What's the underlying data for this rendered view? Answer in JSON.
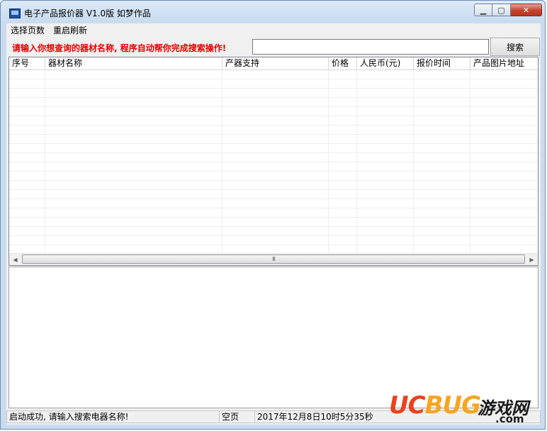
{
  "window": {
    "title": "电子产品报价器 V1.0版 如梦作品",
    "minimize_glyph": "▁",
    "maximize_glyph": "▢",
    "close_glyph": "✕"
  },
  "menu": {
    "items": [
      "选择页数",
      "重启刷新"
    ]
  },
  "search": {
    "prompt": "请输入你想查询的器材名称, 程序自动帮你完成搜索操作!",
    "input_value": "",
    "button_label": "搜索"
  },
  "table": {
    "columns": [
      "序号",
      "器材名称",
      "产器支持",
      "价格",
      "人民币(元)",
      "报价时间",
      "产品图片地址"
    ],
    "rows": []
  },
  "scrollbar": {
    "left_arrow": "◀",
    "right_arrow": "▶",
    "grip": "III"
  },
  "status": {
    "message": "启动成功, 请输入搜索电器名称!",
    "page": "空页",
    "time": "2017年12月8日10时5分35秒"
  },
  "watermark": {
    "brand_uc": "UC",
    "brand_bug": "BUG",
    "brand_cn": "游戏网",
    "brand_domain": ".com"
  },
  "colors": {
    "prompt_text": "#e60000",
    "titlebar": "#c9dbef",
    "close_button": "#c4432d",
    "watermark_orange": "#e8421e",
    "watermark_yellow": "#f6a623"
  }
}
